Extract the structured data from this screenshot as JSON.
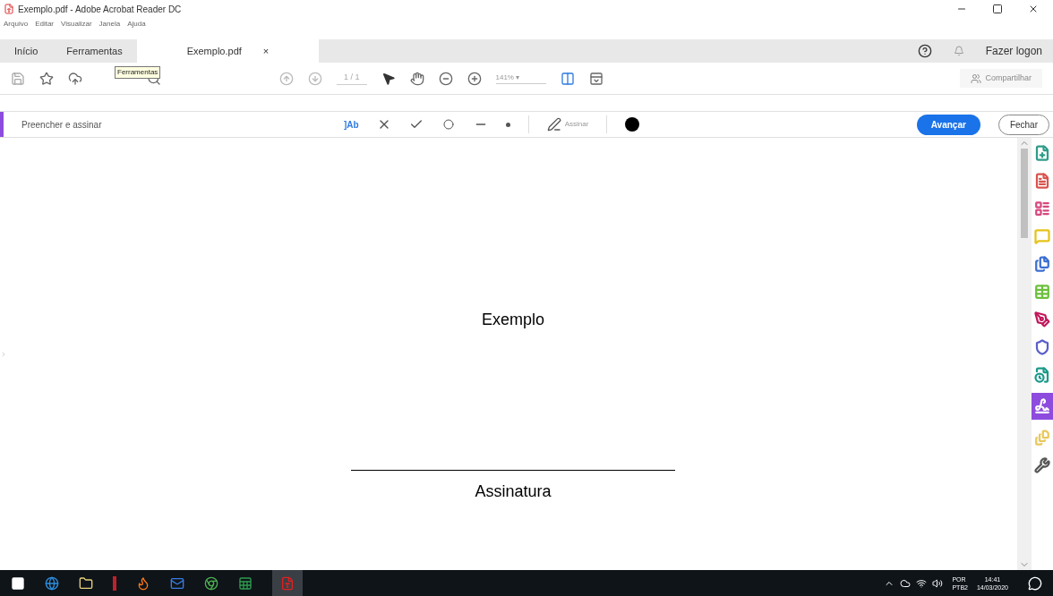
{
  "window": {
    "title": "Exemplo.pdf - Adobe Acrobat Reader DC"
  },
  "menu": [
    "Arquivo",
    "Editar",
    "Visualizar",
    "Janela",
    "Ajuda"
  ],
  "tabs": [
    {
      "label": "Início",
      "selected": false
    },
    {
      "label": "Ferramentas",
      "selected": false
    },
    {
      "label": "Exemplo.pdf",
      "selected": true,
      "close": "×"
    }
  ],
  "account": {
    "login": "Fazer logon"
  },
  "toolbar": {
    "tooltip": "Ferramentas",
    "page": "1 / 1",
    "zoom": "141%",
    "zoom_caret": "▾",
    "share": "Compartilhar"
  },
  "fill_sign": {
    "title": "Preencher e assinar",
    "text_tool": "]Ab",
    "sign": "Assinar",
    "next": "Avançar",
    "close": "Fechar"
  },
  "document": {
    "heading": "Exemplo",
    "signature_label": "Assinatura"
  },
  "right_panel": [
    {
      "selected": false,
      "color": "#2e9c8a"
    },
    {
      "selected": false,
      "color": "#d9534f"
    },
    {
      "selected": false,
      "color": "#d6487e"
    },
    {
      "selected": false,
      "color": "#e6c21a"
    },
    {
      "selected": false,
      "color": "#3b6fd1"
    },
    {
      "selected": false,
      "color": "#6cbf3c"
    },
    {
      "selected": false,
      "color": "#c2185b"
    },
    {
      "selected": false,
      "color": "#5b5fc7"
    },
    {
      "selected": false,
      "color": "#1c9a8c"
    },
    {
      "selected": true,
      "color": "#ffffff"
    },
    {
      "selected": false,
      "color": "#e8c85a"
    },
    {
      "selected": false,
      "color": "#555555"
    }
  ],
  "tray": {
    "lang": "POR",
    "layout": "PTB2",
    "time": "14:41",
    "date": "14/03/2020"
  }
}
